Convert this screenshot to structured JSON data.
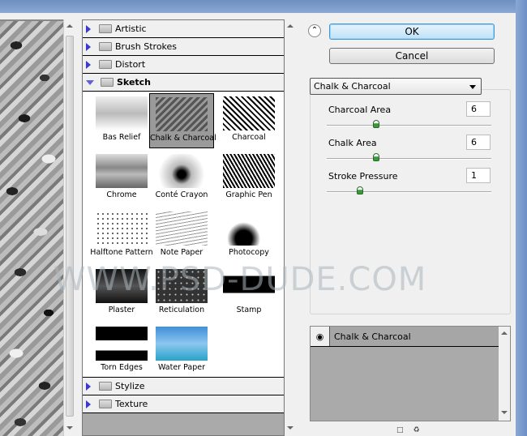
{
  "dialog": {
    "categories_top": [
      {
        "label": "Artistic",
        "expanded": false
      },
      {
        "label": "Brush Strokes",
        "expanded": false
      },
      {
        "label": "Distort",
        "expanded": false
      },
      {
        "label": "Sketch",
        "expanded": true
      }
    ],
    "categories_bottom": [
      {
        "label": "Stylize",
        "expanded": false
      },
      {
        "label": "Texture",
        "expanded": false
      }
    ],
    "sketch_filters": [
      {
        "label": "Bas Relief"
      },
      {
        "label": "Chalk & Charcoal",
        "selected": true
      },
      {
        "label": "Charcoal"
      },
      {
        "label": "Chrome"
      },
      {
        "label": "Conté Crayon"
      },
      {
        "label": "Graphic Pen"
      },
      {
        "label": "Halftone Pattern"
      },
      {
        "label": "Note Paper"
      },
      {
        "label": "Photocopy"
      },
      {
        "label": "Plaster"
      },
      {
        "label": "Reticulation"
      },
      {
        "label": "Stamp"
      },
      {
        "label": "Torn Edges"
      },
      {
        "label": "Water Paper"
      }
    ],
    "buttons": {
      "ok": "OK",
      "cancel": "Cancel",
      "collapse_icon": "double-chevron-up-icon"
    },
    "filter_select": {
      "selected": "Chalk & Charcoal"
    },
    "params": [
      {
        "label": "Charcoal Area",
        "value": "6",
        "min": 0,
        "max": 20,
        "fraction": 0.3
      },
      {
        "label": "Chalk Area",
        "value": "6",
        "min": 0,
        "max": 20,
        "fraction": 0.3
      },
      {
        "label": "Stroke Pressure",
        "value": "1",
        "min": 0,
        "max": 5,
        "fraction": 0.2
      }
    ],
    "layers": [
      {
        "label": "Chalk & Charcoal",
        "visible": true
      }
    ],
    "watermark": "WWW.PSD-DUDE.COM"
  }
}
